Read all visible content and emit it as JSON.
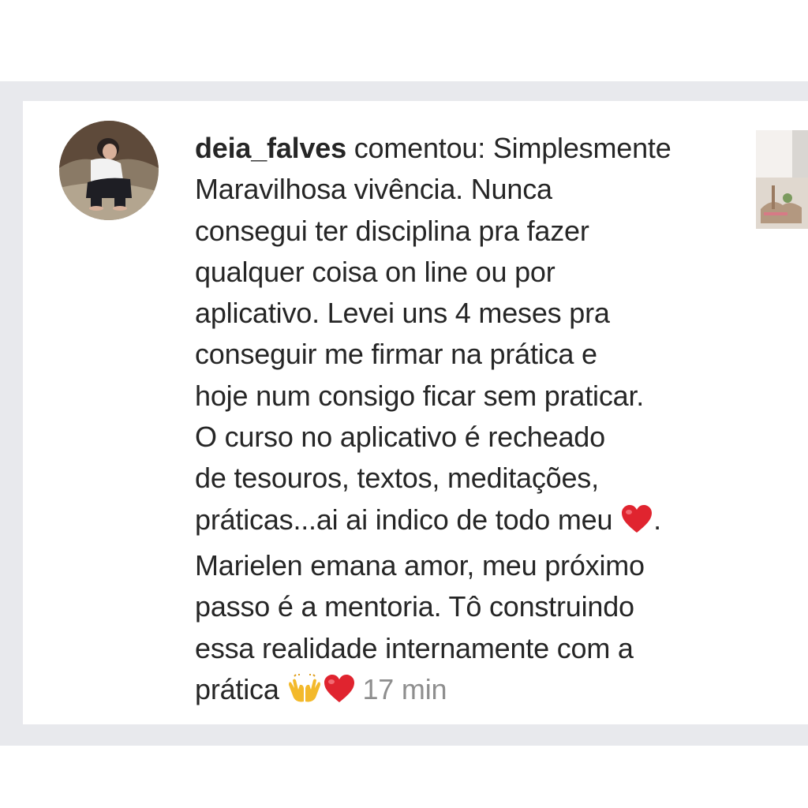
{
  "comment": {
    "username": "deia_falves",
    "verb": " comentou: Simplesmente",
    "lines": [
      "Maravilhosa vivência. Nunca",
      "consegui ter disciplina pra fazer",
      "qualquer coisa on line ou por",
      "aplicativo. Levei uns 4 meses pra",
      "conseguir me firmar na prática e",
      "hoje num consigo ficar sem praticar.",
      "O curso no aplicativo é recheado",
      "de tesouros, textos, meditações,"
    ],
    "line_heart_before": "práticas...ai ai indico de todo meu",
    "line_heart_after": ".",
    "lines_after": [
      "Marielen emana amor, meu próximo",
      "passo é a mentoria. Tô construindo",
      "essa realidade internamente com a"
    ],
    "last_line_text": "prática",
    "timestamp": "17 min",
    "emojis": {
      "heart": "red-heart-icon",
      "raising_hands": "raising-hands-icon"
    }
  },
  "colors": {
    "background": "#ffffff",
    "band": "#e8e9ed",
    "text": "#262626",
    "timestamp": "#8e8e8e",
    "heart": "#e0242f"
  }
}
